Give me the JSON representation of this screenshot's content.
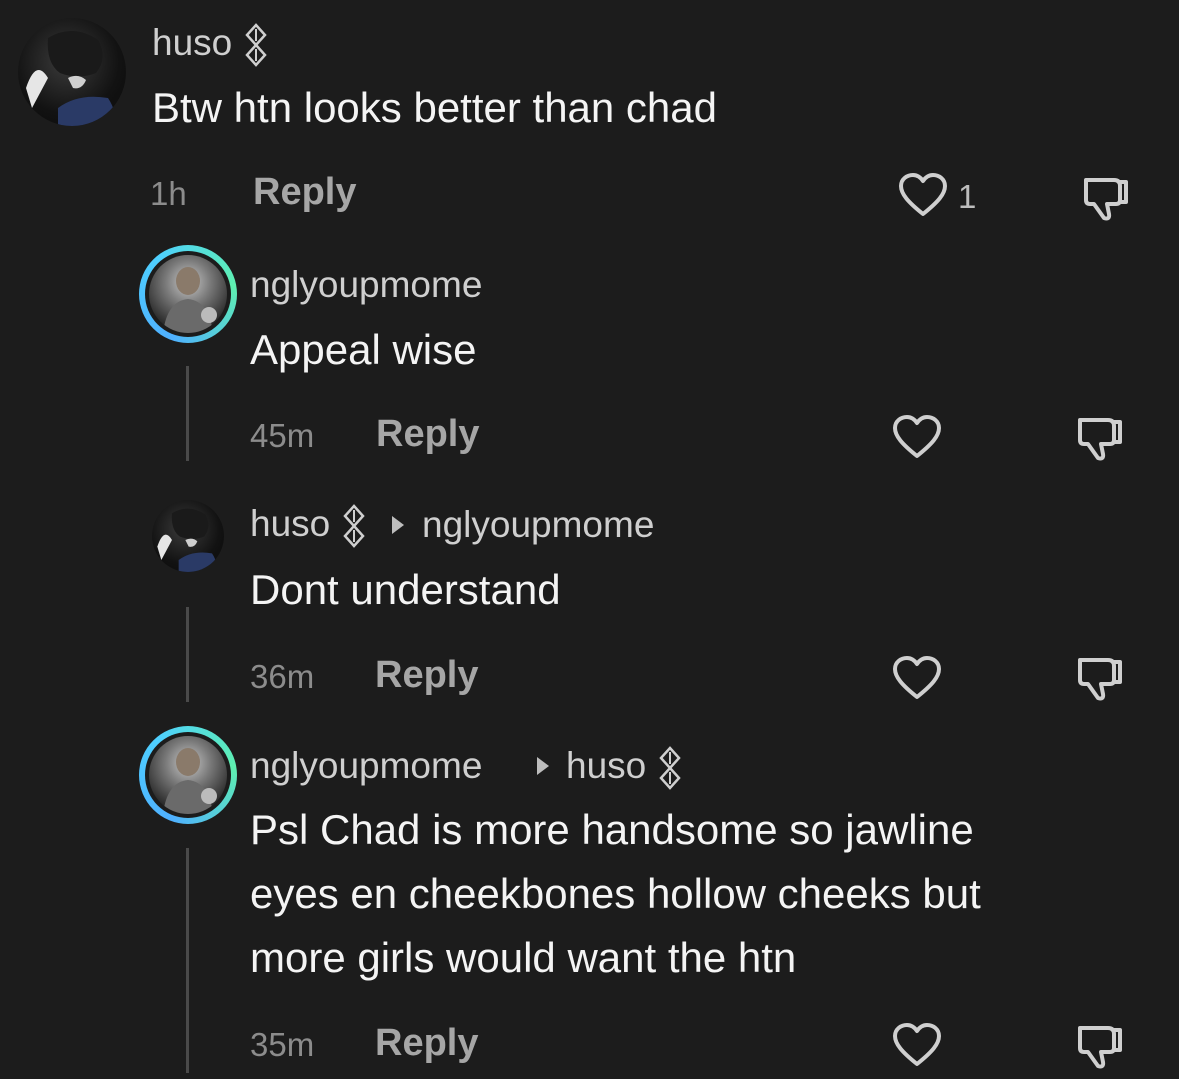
{
  "comments": [
    {
      "username": "huso",
      "text": "Btw htn looks better than chad",
      "time": "1h",
      "reply_label": "Reply",
      "like_count": "1"
    },
    {
      "username": "nglyoupmome",
      "text": "Appeal wise",
      "time": "45m",
      "reply_label": "Reply"
    },
    {
      "username": "huso",
      "reply_to": "nglyoupmome",
      "text": "Dont understand",
      "time": "36m",
      "reply_label": "Reply"
    },
    {
      "username": "nglyoupmome",
      "reply_to": "huso",
      "text_lines": [
        "Psl Chad is more handsome so jawline",
        "eyes en cheekbones hollow cheeks but",
        "more girls would want the htn"
      ],
      "time": "35m",
      "reply_label": "Reply"
    }
  ],
  "colors": {
    "background": "#1c1c1c",
    "ring_gradient_start": "#4fb0ff",
    "ring_gradient_end": "#5ef0b0"
  },
  "icons": [
    "heart-icon",
    "dislike-icon",
    "creator-badge-icon",
    "reply-arrow-icon"
  ]
}
